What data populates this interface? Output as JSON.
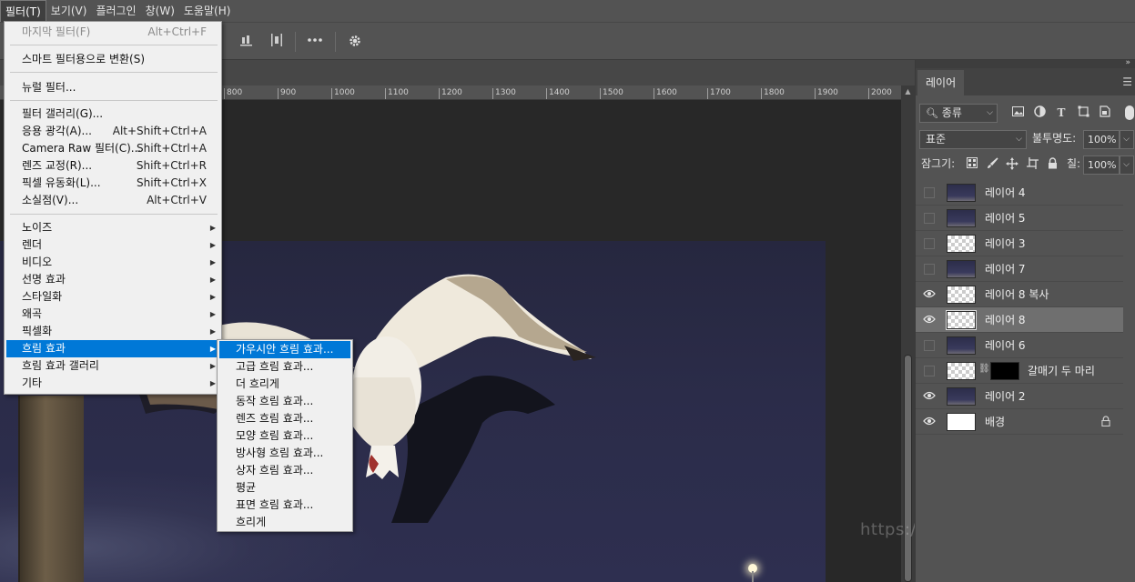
{
  "menubar": {
    "items": [
      "필터(T)",
      "보기(V)",
      "플러그인",
      "창(W)",
      "도움말(H)"
    ],
    "active_index": 0
  },
  "ruler": {
    "ticks": [
      "800",
      "900",
      "1000",
      "1100",
      "1200",
      "1300",
      "1400",
      "1500",
      "1600",
      "1700",
      "1800",
      "1900",
      "2000"
    ]
  },
  "filter_menu": {
    "items": [
      {
        "label": "마지막 필터(F)",
        "shortcut": "Alt+Ctrl+F",
        "disabled": true
      },
      {
        "label": "스마트 필터용으로 변환(S)",
        "shortcut": ""
      },
      {
        "label": "뉴럴 필터...",
        "shortcut": ""
      },
      {
        "label": "필터 갤러리(G)...",
        "shortcut": ""
      },
      {
        "label": "응용 광각(A)...",
        "shortcut": "Alt+Shift+Ctrl+A"
      },
      {
        "label": "Camera Raw 필터(C)...",
        "shortcut": "Shift+Ctrl+A"
      },
      {
        "label": "렌즈 교정(R)...",
        "shortcut": "Shift+Ctrl+R"
      },
      {
        "label": "픽셀 유동화(L)...",
        "shortcut": "Shift+Ctrl+X"
      },
      {
        "label": "소실점(V)...",
        "shortcut": "Alt+Ctrl+V"
      },
      {
        "label": "노이즈",
        "submenu": true
      },
      {
        "label": "렌더",
        "submenu": true
      },
      {
        "label": "비디오",
        "submenu": true
      },
      {
        "label": "선명 효과",
        "submenu": true
      },
      {
        "label": "스타일화",
        "submenu": true
      },
      {
        "label": "왜곡",
        "submenu": true
      },
      {
        "label": "픽셀화",
        "submenu": true
      },
      {
        "label": "흐림 효과",
        "submenu": true,
        "highlighted": true
      },
      {
        "label": "흐림 효과 갤러리",
        "submenu": true
      },
      {
        "label": "기타",
        "submenu": true
      }
    ]
  },
  "blur_submenu": {
    "items": [
      {
        "label": "가우시안 흐림 효과...",
        "highlighted": true
      },
      {
        "label": "고급 흐림 효과..."
      },
      {
        "label": "더 흐리게"
      },
      {
        "label": "동작 흐림 효과..."
      },
      {
        "label": "렌즈 흐림 효과..."
      },
      {
        "label": "모양 흐림 효과..."
      },
      {
        "label": "방사형 흐림 효과..."
      },
      {
        "label": "상자 흐림 효과..."
      },
      {
        "label": "평균"
      },
      {
        "label": "표면 흐림 효과..."
      },
      {
        "label": "흐리게"
      }
    ]
  },
  "layers_panel": {
    "tab": "레이어",
    "filter_kind": "종류",
    "blend_mode": "표준",
    "opacity_label": "불투명도:",
    "opacity_value": "100%",
    "lock_label": "잠그기:",
    "fill_label": "칠:",
    "fill_value": "100%",
    "layers": [
      {
        "name": "레이어 4",
        "visible": false,
        "thumb": "dark"
      },
      {
        "name": "레이어 5",
        "visible": false,
        "thumb": "dark"
      },
      {
        "name": "레이어 3",
        "visible": false,
        "thumb": "check"
      },
      {
        "name": "레이어 7",
        "visible": false,
        "thumb": "dark"
      },
      {
        "name": "레이어 8 복사",
        "visible": true,
        "thumb": "check"
      },
      {
        "name": "레이어 8",
        "visible": true,
        "thumb": "check",
        "selected": true
      },
      {
        "name": "레이어 6",
        "visible": false,
        "thumb": "dark"
      },
      {
        "name": "갈매기 두 마리",
        "visible": false,
        "thumb": "check",
        "has_mask": true
      },
      {
        "name": "레이어 2",
        "visible": true,
        "thumb": "dark"
      },
      {
        "name": "배경",
        "visible": true,
        "thumb": "white",
        "locked": true
      }
    ]
  },
  "watermark": "https://mapoman.tistory.com",
  "colors": {
    "menu_highlight": "#0078d7",
    "panel_bg": "#535353",
    "canvas_sky": "#2b2c49"
  }
}
